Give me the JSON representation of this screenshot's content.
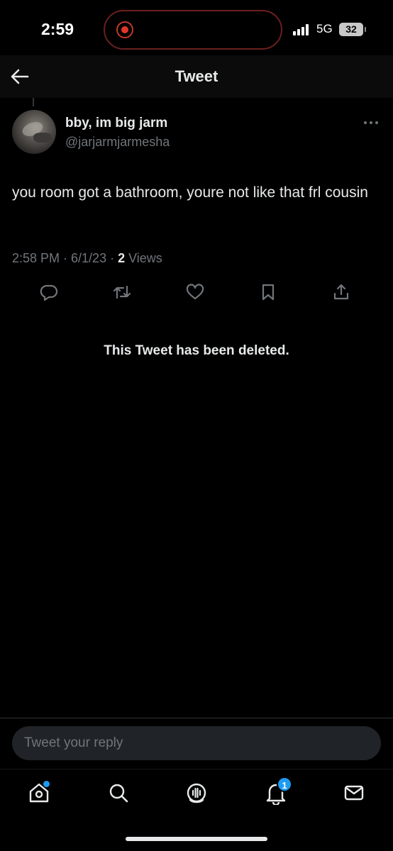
{
  "status_bar": {
    "time": "2:59",
    "network": "5G",
    "battery": "32"
  },
  "header": {
    "title": "Tweet"
  },
  "tweet": {
    "display_name": "bby, im big jarm",
    "handle": "@jarjarmjarmesha",
    "text": "you room got a bathroom, youre not like that frl cousin",
    "timestamp": "2:58 PM · 6/1/23 · ",
    "views_count": "2",
    "views_label": " Views"
  },
  "deleted_notice": "This Tweet has been deleted.",
  "reply": {
    "placeholder": "Tweet your reply"
  },
  "tabbar": {
    "notifications_badge": "1"
  },
  "colors": {
    "accent": "#1d9bf0",
    "background": "#000000",
    "text_primary": "#e7e9ea",
    "text_secondary": "#71767b"
  }
}
